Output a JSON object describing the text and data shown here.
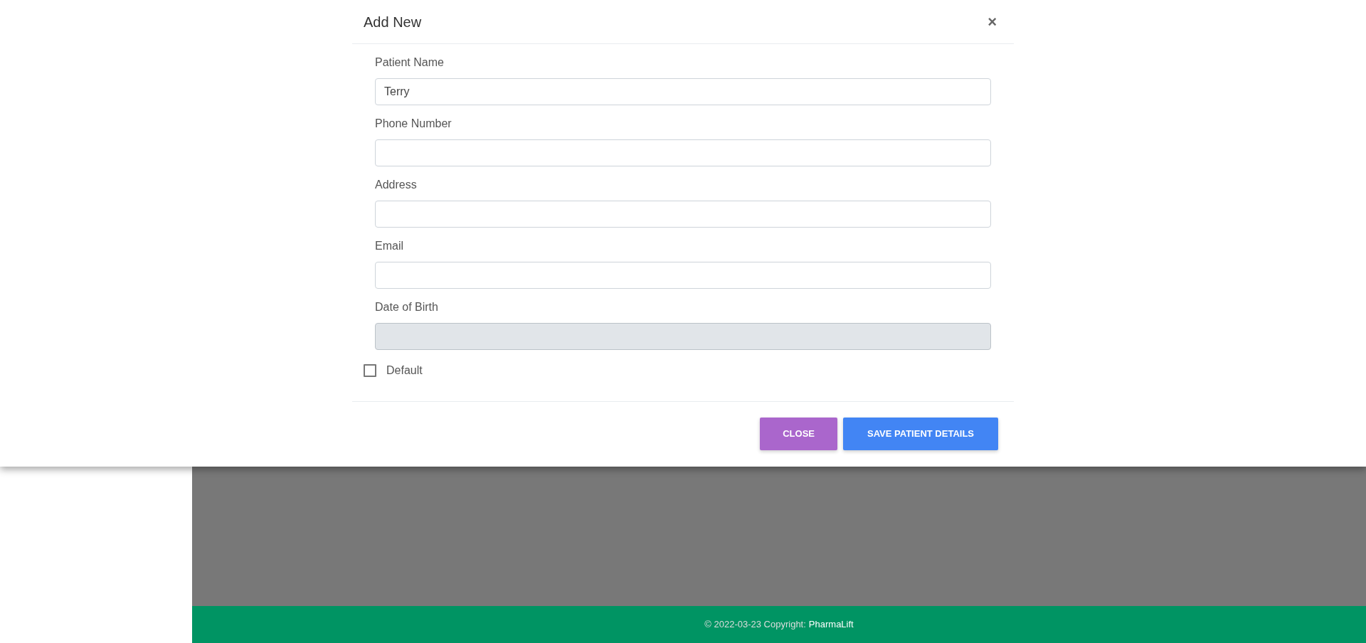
{
  "modal": {
    "title": "Add New",
    "close_symbol": "×"
  },
  "fields": [
    {
      "label": "Patient Name",
      "value": "Terry",
      "disabled": false
    },
    {
      "label": "Phone Number",
      "disabled": false
    },
    {
      "label": "Address",
      "disabled": false
    },
    {
      "label": "Email",
      "disabled": false
    },
    {
      "label": "Date of Birth",
      "disabled": true
    }
  ],
  "checkbox": {
    "label": "Default",
    "checked": false
  },
  "buttons": [
    {
      "label": "CLOSE",
      "kind": "secondary"
    },
    {
      "label": "SAVE PATIENT DETAILS",
      "kind": "primary"
    }
  ],
  "footer": {
    "text": "© 2022-03-23 Copyright:",
    "link": "PharmaLift"
  }
}
